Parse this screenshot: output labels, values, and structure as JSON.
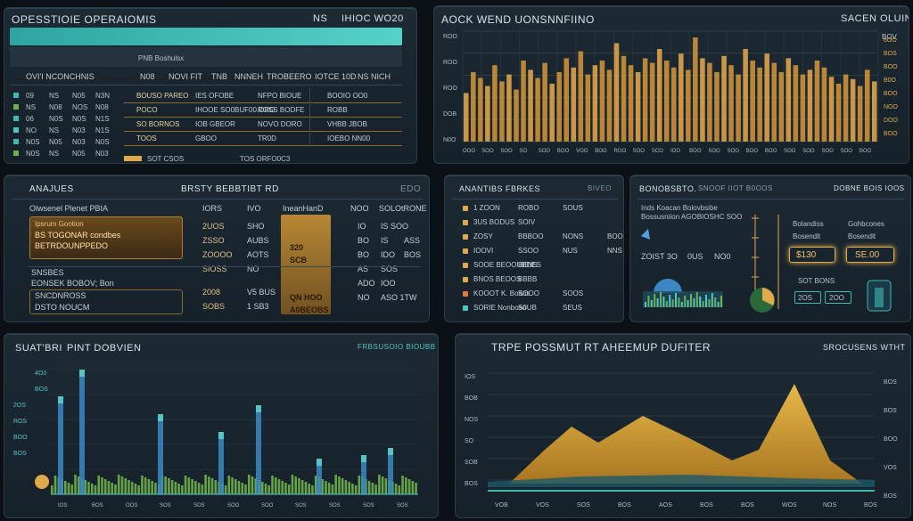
{
  "colors": {
    "accent_gold": "#e0a94a",
    "accent_teal": "#3fb8b0",
    "accent_green": "#6fb04a",
    "bg": "#0b1116"
  },
  "ops": {
    "title": "OPESSTIOIE OPERAIOMIS",
    "header_right": [
      "NS",
      "IHIOC WO20"
    ],
    "subheader": "PNB Boshulsx",
    "col_row": [
      "OVI'I NCONCHNIS",
      "N08",
      "NOVI FIT",
      "TNB",
      "NNNEH",
      "TROBEERO",
      "IOTCE 10D",
      "NS NICH"
    ],
    "left_rows": [
      [
        "09",
        "NS",
        "N05",
        "N3N"
      ],
      [
        "NS",
        "N08",
        "NOS",
        "N08"
      ],
      [
        "06",
        "N0S",
        "N0S",
        "N1S"
      ],
      [
        "NO",
        "NS",
        "N03",
        "N1S"
      ],
      [
        "N0S",
        "N05",
        "N03",
        "N0S"
      ],
      [
        "N0S",
        "NS",
        "N05",
        "N03"
      ]
    ],
    "table_rows": [
      [
        "BOUSO PAREO",
        "IES OFOBE",
        "NFPO BIOUE",
        "BOOIO OO0"
      ],
      [
        "POCO",
        "IHOOE SO0BUF00.ORO",
        "ROSS BODFE",
        "ROBB"
      ],
      [
        "SO BORNOS",
        "IOB GBEOR",
        "NOVO DORO",
        "VHBB JBOB"
      ],
      [
        "TOOS",
        "GBOO",
        "TR0D",
        "IOEBO NN00"
      ]
    ],
    "footer": [
      "SOT CSOS",
      "TOS ORFO0C3"
    ]
  },
  "bar_panel": {
    "title": "AOCK WEND UONSNNFIINO",
    "right_title": "SACEN OLUIN",
    "sub_right": "BOV",
    "ylabels": [
      "ROO",
      "ROO",
      "ROO",
      "DOB",
      "N0O"
    ],
    "xlabels": [
      "OOO",
      "SOO",
      "SOO",
      "SO",
      "SOO",
      "BOO",
      "VOO",
      "BOO",
      "ROO",
      "SOO",
      "SCO",
      "IOO",
      "BOO",
      "SOO",
      "SOO",
      "BOO",
      "BOO",
      "SOO",
      "SOO",
      "SOO",
      "SOO",
      "BOO"
    ],
    "right_labels": [
      "6OO",
      "BOS",
      "BOO",
      "B0O",
      "BOO",
      "NOO",
      "DOO",
      "BOO"
    ]
  },
  "analys": {
    "title": "ANAJUES",
    "mid_title": "BRSTY BEBBTIBT RD",
    "right_title": "EDO",
    "head": [
      "Olwsenel Plenet PBIA",
      "IORS",
      "IVO",
      "IneanHanD",
      "NOO",
      "SOLOtRONE"
    ],
    "card1": [
      "Ipsrum Gontion",
      "BS TOGONAR condbes",
      "BETRDOUNPPEDO"
    ],
    "cols": [
      [
        "2UOS",
        "ZSSO",
        "ZOOOO",
        "SIOSS",
        "2008",
        "SOBS"
      ],
      [
        "SHO",
        "AUBS",
        "AOTS",
        "NO",
        "V5 BUS",
        "1 SB3"
      ]
    ],
    "gold_box": [
      "320",
      "SCB",
      "QN HOO",
      "A0BEOBS"
    ],
    "rows_right": [
      [
        "IO",
        "IS SOO"
      ],
      [
        "BO",
        "IS",
        "ASS"
      ],
      [
        "BO",
        "IDO",
        "BOS"
      ],
      [
        "AS",
        "SOS"
      ],
      [
        "ADO",
        "IOO"
      ],
      [
        "NO",
        "ASO 1TW"
      ]
    ],
    "footer_left": [
      "SNSBES",
      "EONSEK BOBOV; Bon",
      "SNCDNROSS",
      "DSTO NOUCM"
    ]
  },
  "analytics": {
    "title": "ANANTIBS FBRKES",
    "right": "BIVEO",
    "rows": [
      [
        "1 ZOON",
        "ROBO",
        "SOUS"
      ],
      [
        "3US BODUS",
        "SOIV"
      ],
      [
        "ZOSY",
        "BBBOO",
        "NONS",
        "BOO"
      ],
      [
        "IOOVI",
        "SSOO",
        "NUS",
        "NNS"
      ],
      [
        "SOOE BEOOUBDES",
        "BENS"
      ],
      [
        "BNOS BEOOS",
        "BBBB"
      ],
      [
        "KOOOT K. Boans",
        "SOOO",
        "SOOS"
      ],
      [
        "SORIE Nonboso",
        "S0UB",
        "SEUS"
      ]
    ]
  },
  "conn": {
    "title": "BONOBSBTO.",
    "title2": "SNOOF IIOT B0OOS",
    "right": "DOBNE BOIS IOOS",
    "lines": [
      "Inds Koacan Bolovbsibe",
      "Bossusniion AGOBIOSHC SOO"
    ],
    "labels": [
      "ZOIST 3O",
      "0US",
      "NO0"
    ],
    "right_labels": [
      "Bolandiss",
      "Bosendlt",
      "Gohbcones",
      "Bosendlt"
    ],
    "gold_values": [
      "$130",
      "SE.00"
    ],
    "bottom": [
      "ZOS",
      "2OS",
      "2OO",
      "SOT BONS"
    ]
  },
  "bottom_left": {
    "title": "SUAT'BRI",
    "title2": "PINT DOBVIEN",
    "right": "FRBSUSOIO BIOUBB",
    "ylabels": [
      "4O0",
      "BOS",
      "2OS",
      "ROS",
      "BOO",
      "BOS"
    ],
    "xlabels": [
      "IOS",
      "BOS",
      "OOS",
      "SOS",
      "SOS",
      "SOO",
      "SOO",
      "SOS",
      "SOS",
      "SOS",
      "SOS"
    ]
  },
  "area": {
    "title": "TRPE POSSMUT RT AHEEMUP DUFITER",
    "right": "SROCUSENS WTHT",
    "ylabels": [
      "IOS",
      "BOB",
      "NOS",
      "SO",
      "SOB",
      "BOS"
    ],
    "xlabels": [
      "VOB",
      "VOS",
      "SOS",
      "BOS",
      "AOS",
      "BOS",
      "BOS",
      "WOS",
      "NOS",
      "BOS"
    ],
    "right_labels": [
      "BOS",
      "BOS",
      "BOO",
      "VOS",
      "BOS"
    ]
  }
}
